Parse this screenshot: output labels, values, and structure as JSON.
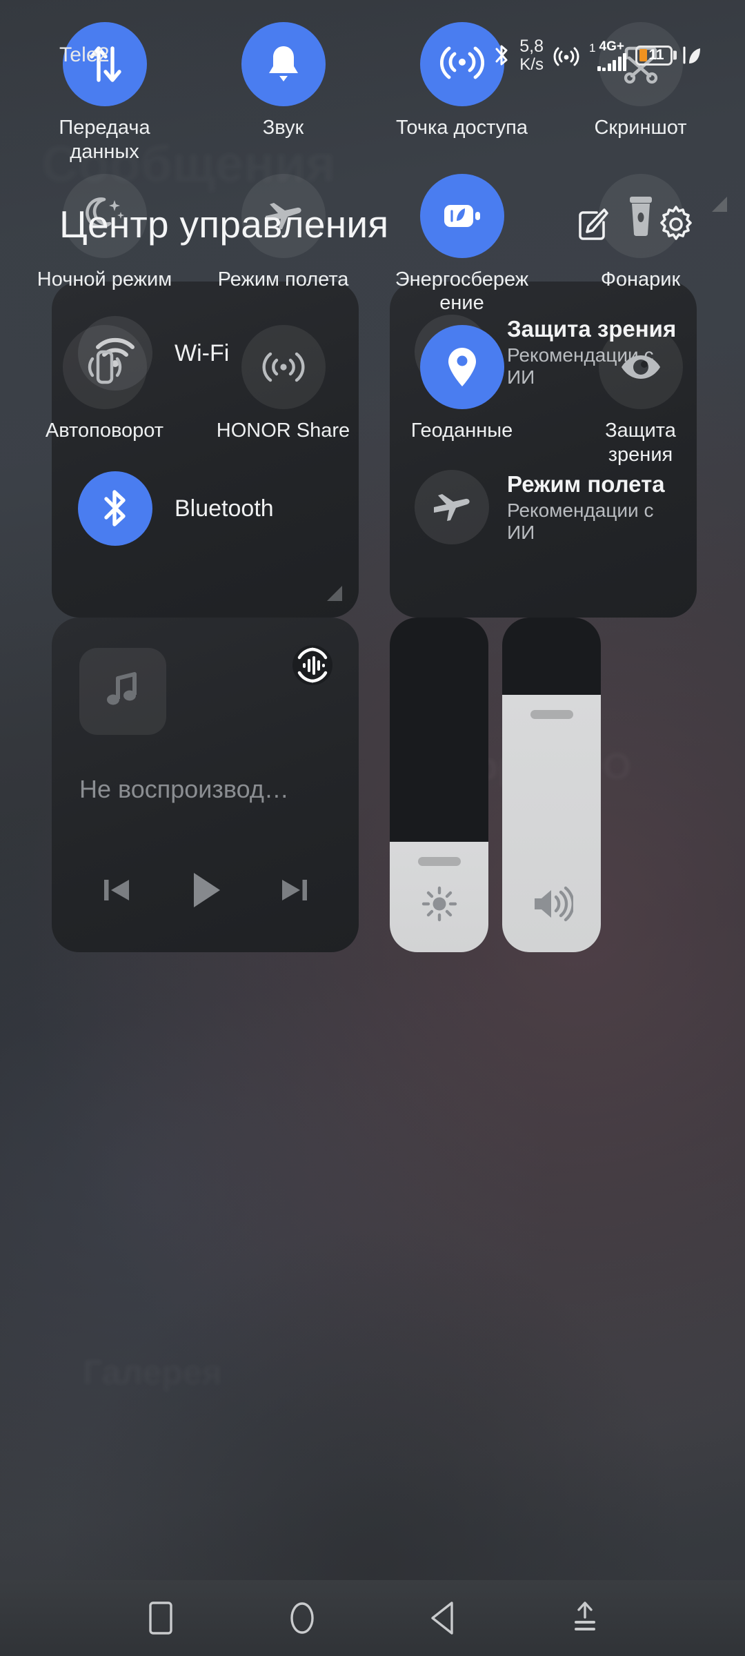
{
  "statusbar": {
    "carrier": "Tele2",
    "bluetooth_icon": "bluetooth-icon",
    "net_speed_value": "5,8",
    "net_speed_unit": "K/s",
    "hotspot_icon": "hotspot-icon",
    "sim_number": "1",
    "network_generation": "4G+",
    "signal_icon": "signal-bars-icon",
    "battery_level": "11",
    "battery_accent": "#f0921f",
    "power_saving_icon": "leaf-icon"
  },
  "header": {
    "title": "Центр управления",
    "edit_icon": "edit-icon",
    "settings_icon": "gear-icon"
  },
  "connectivity_card": {
    "items": [
      {
        "label": "Wi-Fi",
        "icon": "wifi-icon",
        "state": "off"
      },
      {
        "label": "Bluetooth",
        "icon": "bluetooth-icon",
        "state": "on"
      }
    ]
  },
  "ai_card": {
    "items": [
      {
        "title": "Защита зрения",
        "subtitle": "Рекомендации с ИИ",
        "icon": "eye-icon",
        "state": "off"
      },
      {
        "title": "Режим полета",
        "subtitle": "Рекомендации с ИИ",
        "icon": "airplane-icon",
        "state": "off"
      }
    ]
  },
  "media_card": {
    "title": "Не воспроизвод…",
    "album_art_icon": "music-note-icon",
    "cast_icon": "audio-output-icon",
    "prev_icon": "skip-previous-icon",
    "play_icon": "play-icon",
    "next_icon": "skip-next-icon"
  },
  "sliders": [
    {
      "name": "brightness",
      "icon": "brightness-icon",
      "value_percent": 33
    },
    {
      "name": "volume",
      "icon": "volume-icon",
      "value_percent": 77
    }
  ],
  "toggles": [
    {
      "label": "Передача данных",
      "icon": "data-transfer-icon",
      "state": "on"
    },
    {
      "label": "Звук",
      "icon": "bell-icon",
      "state": "on"
    },
    {
      "label": "Точка доступа",
      "icon": "hotspot-icon",
      "state": "on"
    },
    {
      "label": "Скриншот",
      "icon": "screenshot-scissors-icon",
      "state": "off"
    },
    {
      "label": "Ночной режим",
      "icon": "night-mode-icon",
      "state": "off"
    },
    {
      "label": "Режим полета",
      "icon": "airplane-icon",
      "state": "off"
    },
    {
      "label": "Энергосбережение",
      "icon": "power-saving-icon",
      "state": "on"
    },
    {
      "label": "Фонарик",
      "icon": "flashlight-icon",
      "state": "off"
    },
    {
      "label": "Автоповорот",
      "icon": "auto-rotate-icon",
      "state": "off"
    },
    {
      "label": "HONOR Share",
      "icon": "honor-share-icon",
      "state": "off"
    },
    {
      "label": "Геоданные",
      "icon": "location-pin-icon",
      "state": "on"
    },
    {
      "label": "Защита зрения",
      "icon": "eye-icon",
      "state": "off"
    }
  ],
  "expand_handle_icon": "chevron-down-icon",
  "navbar": {
    "items": [
      {
        "name": "recents",
        "icon": "square-icon"
      },
      {
        "name": "home",
        "icon": "circle-icon"
      },
      {
        "name": "back",
        "icon": "triangle-left-icon"
      },
      {
        "name": "hide-navbar",
        "icon": "arrow-up-lines-icon"
      }
    ]
  },
  "colors": {
    "accent_blue": "#4a7df0",
    "card_bg": "#232528",
    "slider_fill": "#d4d5d6",
    "battery_orange": "#f0921f"
  }
}
